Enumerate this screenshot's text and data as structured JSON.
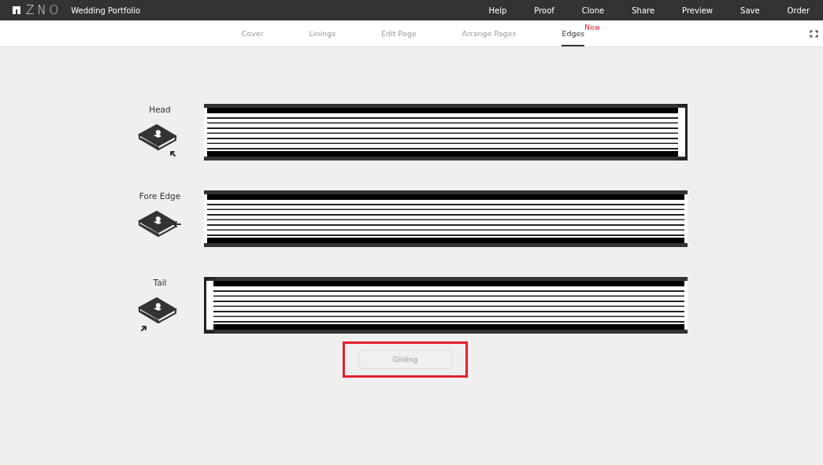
{
  "topbar": {
    "logo": "ZNO",
    "project_title": "Wedding Portfolio",
    "menu": [
      "Help",
      "Proof",
      "Clone",
      "Share",
      "Preview",
      "Save",
      "Order"
    ]
  },
  "tabs": [
    {
      "label": "Cover",
      "selected": false
    },
    {
      "label": "Linings",
      "selected": false
    },
    {
      "label": "Edit Page",
      "selected": false
    },
    {
      "label": "Arrange Pages",
      "selected": false
    },
    {
      "label": "Edges",
      "selected": true,
      "badge": "New"
    }
  ],
  "edges": [
    {
      "kind": "head",
      "label": "Head"
    },
    {
      "kind": "fore",
      "label": "Fore Edge"
    },
    {
      "kind": "tail",
      "label": "Tail"
    }
  ],
  "gilding_button": {
    "label": "Gilding",
    "highlighted": true
  }
}
